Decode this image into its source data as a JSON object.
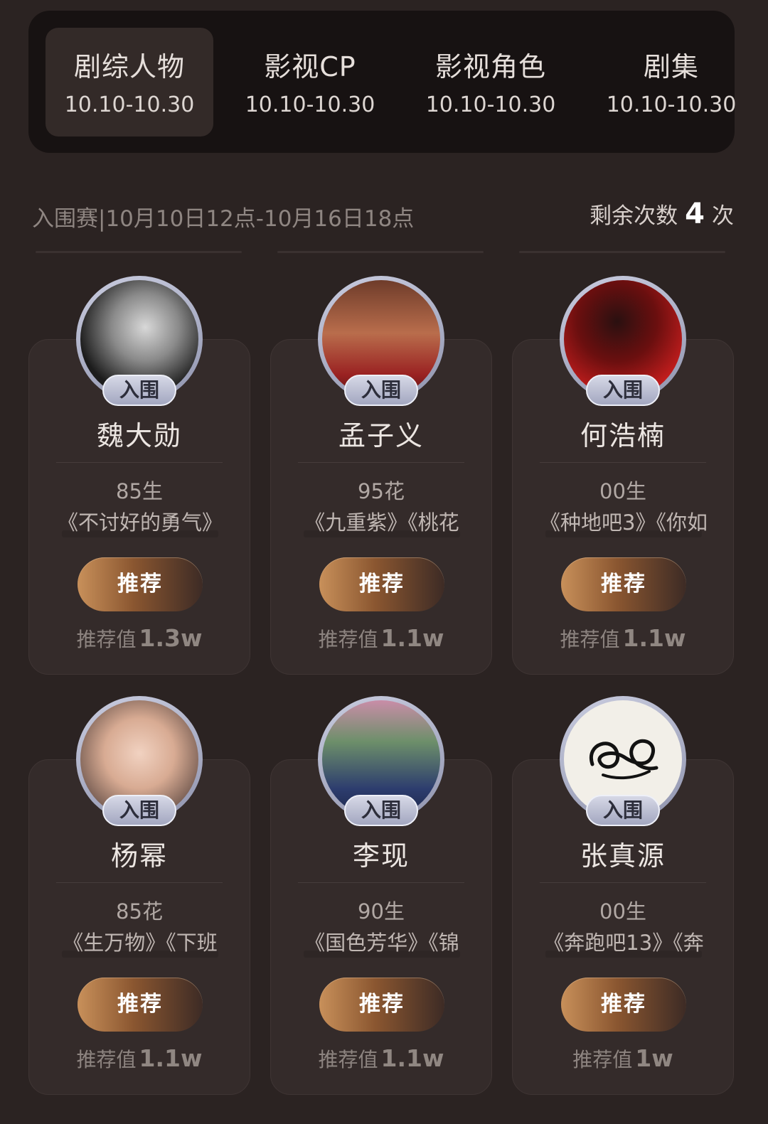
{
  "tabs": [
    {
      "title": "剧综人物",
      "date": "10.10-10.30",
      "active": true
    },
    {
      "title": "影视CP",
      "date": "10.10-10.30",
      "active": false
    },
    {
      "title": "影视角色",
      "date": "10.10-10.30",
      "active": false
    },
    {
      "title": "剧集",
      "date": "10.10-10.30",
      "active": false
    }
  ],
  "round": {
    "info": "入围赛|10月10日12点-10月16日18点",
    "remaining_label": "剩余次数",
    "remaining_count": "4",
    "remaining_unit": "次"
  },
  "cards": [
    {
      "badge": "入围",
      "name": "魏大勋",
      "tag": "85生",
      "works": "《不讨好的勇气》",
      "button": "推荐",
      "score_label": "推荐值",
      "score": "1.3w",
      "avatar": "portrait-bw"
    },
    {
      "badge": "入围",
      "name": "孟子义",
      "tag": "95花",
      "works": "《九重紫》《桃花",
      "button": "推荐",
      "score_label": "推荐值",
      "score": "1.1w",
      "avatar": "portrait-red-dress"
    },
    {
      "badge": "入围",
      "name": "何浩楠",
      "tag": "00生",
      "works": "《种地吧3》《你如",
      "button": "推荐",
      "score_label": "推荐值",
      "score": "1.1w",
      "avatar": "portrait-red-background"
    },
    {
      "badge": "入围",
      "name": "杨幂",
      "tag": "85花",
      "works": "《生万物》《下班",
      "button": "推荐",
      "score_label": "推荐值",
      "score": "1.1w",
      "avatar": "portrait-child"
    },
    {
      "badge": "入围",
      "name": "李现",
      "tag": "90生",
      "works": "《国色芳华》《锦",
      "button": "推荐",
      "score_label": "推荐值",
      "score": "1.1w",
      "avatar": "portrait-costume"
    },
    {
      "badge": "入围",
      "name": "张真源",
      "tag": "00生",
      "works": "《奔跑吧13》《奔",
      "button": "推荐",
      "score_label": "推荐值",
      "score": "1w",
      "avatar": "signature-logo"
    }
  ],
  "colors": {
    "background": "#2b2322",
    "card": "#342b2a",
    "tabbar": "#171212",
    "button_gold": "#c8905a",
    "badge": "#a3a7c0"
  }
}
